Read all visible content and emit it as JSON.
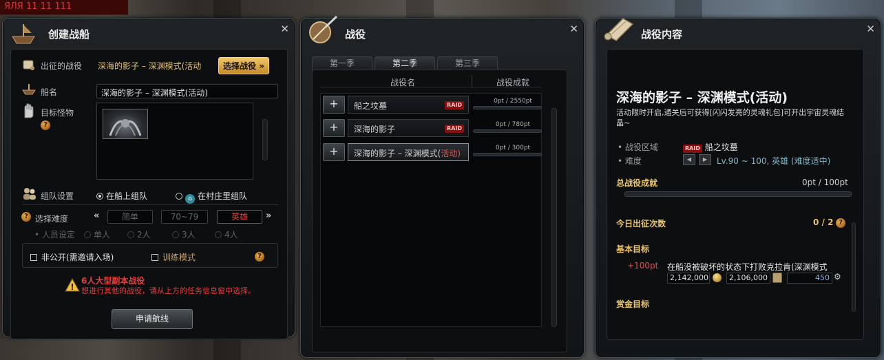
{
  "corner_fragment": "ЯЛЯ 11 11 111",
  "create_ship": {
    "title": "创建战船",
    "campaign_label": "出征的战役",
    "campaign_value": "深海的影子 – 深渊模式(活动",
    "select_campaign_button": "选择战役",
    "ship_name_label": "船名",
    "ship_name_value": "深海的影子 – 深渊模式(活动)",
    "target_monster_label": "目标怪物",
    "party_settings_label": "组队设置",
    "party_on_ship": "在船上组队",
    "party_in_village": "在村庄里组队",
    "difficulty_label": "选择难度",
    "difficulty_options": [
      "简单",
      "70~79",
      "英雄"
    ],
    "members_label": "人员设定",
    "member_options": [
      "单人",
      "2人",
      "3人",
      "4人"
    ],
    "private_checkbox": "非公开(需邀请入场)",
    "training_checkbox": "训练模式",
    "warning_title": "6人大型副本战役",
    "warning_text": "想进行其他的战役，请从上方的任务信息窗中选择。",
    "apply_button": "申请航线"
  },
  "campaign": {
    "title": "战役",
    "tabs": [
      "第一季",
      "第二季",
      "第三季"
    ],
    "col_name": "战役名",
    "col_achievement": "战役成就",
    "rows": [
      {
        "name": "船之坟墓",
        "tag": "RAID",
        "pt": "0pt / 2550pt",
        "progress": 0
      },
      {
        "name": "深海的影子",
        "tag": "RAID",
        "pt": "0pt / 780pt",
        "progress": 0
      },
      {
        "name": "深海的影子 – 深渊模式(",
        "suffix": "活动)",
        "pt": "0pt / 300pt",
        "progress": 0
      }
    ]
  },
  "content": {
    "title": "战役内容",
    "campaign_title": "深海的影子 – 深渊模式(活动)",
    "description": "活动限时开启,通关后可获得[闪闪发亮的灵魂礼包]可开出宇宙灵魂结晶~",
    "zone_label": "战役区域",
    "zone_tag": "RAID",
    "zone_value": "船之坟墓",
    "difficulty_label": "难度",
    "difficulty_value": "Lv.90 ~ 100, 英雄 (难度适中)",
    "total_label": "总战役成就",
    "total_value": "0pt / 100pt",
    "total_progress": 0,
    "daily_label": "今日出征次数",
    "daily_value": "0 / 2",
    "basic_goal_label": "基本目标",
    "basic_goal_pt": "+100pt",
    "basic_goal_text": "在船没被破坏的状态下打败克拉肯(深渊模式",
    "reward_gold": "2,142,000",
    "reward_exp": "2,106,000",
    "reward_other": "450",
    "bounty_label": "赏金目标"
  },
  "colors": {
    "gold": "#e9c36a",
    "raid_red": "#8a1010",
    "warning_red": "#e04040",
    "accent_blue": "#7fb6c8"
  },
  "icons": [
    "ship-icon",
    "scroll-icon",
    "anchor-icon",
    "glove-icon",
    "party-icon",
    "warning-icon",
    "help-icon",
    "close-icon",
    "coin-icon",
    "home-icon"
  ]
}
